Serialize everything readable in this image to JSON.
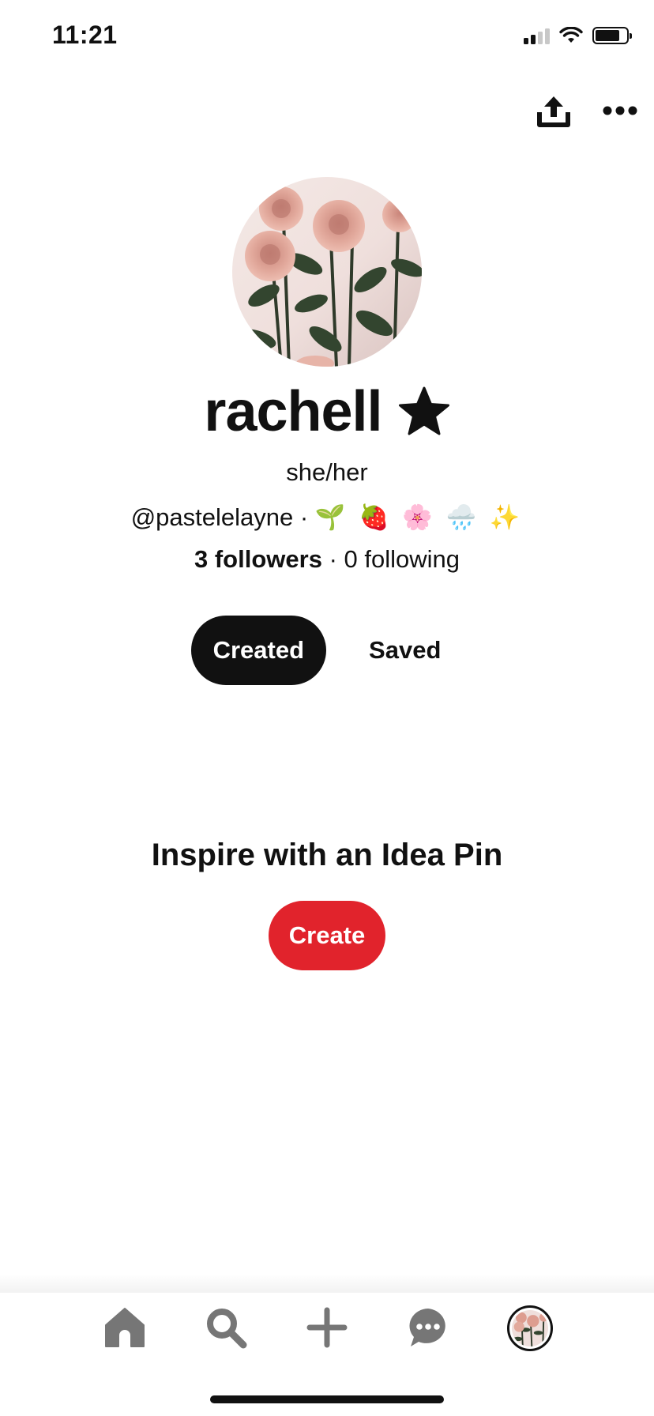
{
  "status_bar": {
    "time": "11:21",
    "icons": [
      "cellular-signal-icon",
      "wifi-icon",
      "battery-icon"
    ]
  },
  "header": {
    "actions": [
      "share-icon",
      "more-options-icon"
    ]
  },
  "profile": {
    "display_name": "rachell",
    "name_icon": "star-icon",
    "pronouns": "she/her",
    "handle": "@pastelelayne",
    "separator": "·",
    "bio_emoji": "🌱 🍓 🌸 🌧️ ✨",
    "followers": "3 followers",
    "following": "0 following"
  },
  "tabs": [
    {
      "label": "Created",
      "active": true
    },
    {
      "label": "Saved",
      "active": false
    }
  ],
  "empty_state": {
    "title": "Inspire with an Idea Pin",
    "button_label": "Create"
  },
  "bottom_nav": {
    "items": [
      "home-icon",
      "search-icon",
      "add-icon",
      "messages-icon",
      "profile-avatar"
    ]
  },
  "colors": {
    "accent_red": "#e1232c",
    "primary_text": "#111111",
    "nav_icon": "#767676"
  }
}
